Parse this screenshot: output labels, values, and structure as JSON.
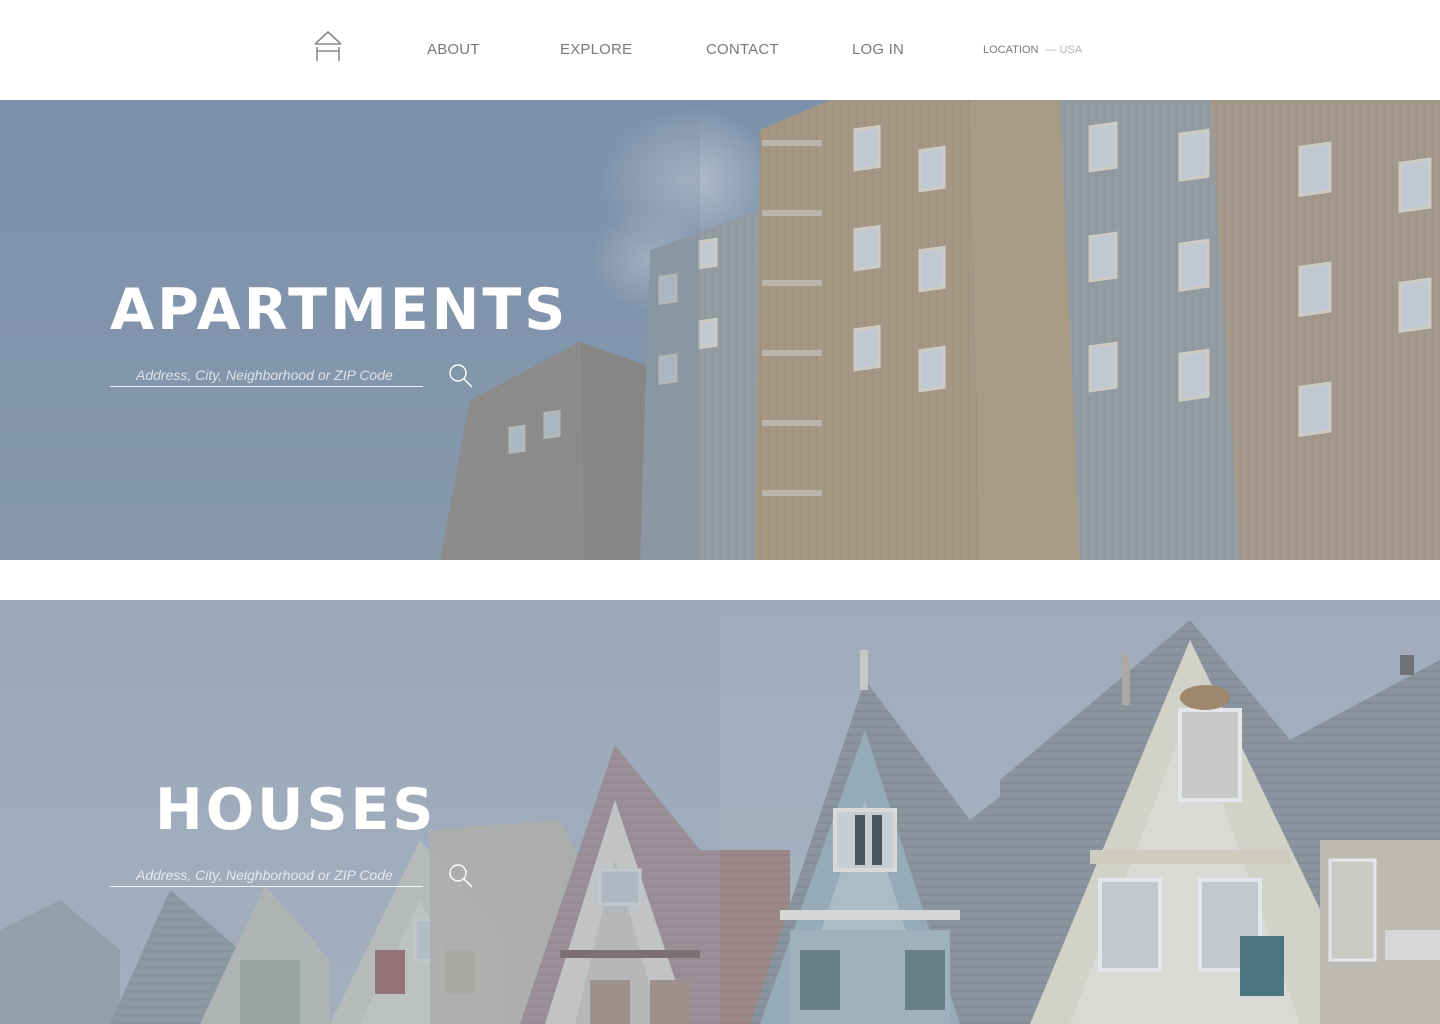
{
  "nav": {
    "logo_icon": "house-outline-icon",
    "links": [
      {
        "label": "ABOUT"
      },
      {
        "label": "EXPLORE"
      },
      {
        "label": "CONTACT"
      },
      {
        "label": "LOG IN"
      }
    ],
    "location": {
      "label": "LOCATION",
      "value": "— USA"
    }
  },
  "sections": {
    "apartments": {
      "title": "APARTMENTS",
      "search_placeholder": "Address, City, Neighborhood or ZIP Code",
      "search_icon": "search-icon"
    },
    "houses": {
      "title": "HOUSES",
      "search_placeholder": "Address, City, Neighborhood or ZIP Code",
      "search_icon": "search-icon"
    }
  },
  "colors": {
    "nav_text": "#7a7a7a",
    "location_value": "#b5b5b5",
    "hero_text": "#ffffff",
    "sky_overlay": "#7f93aa"
  }
}
